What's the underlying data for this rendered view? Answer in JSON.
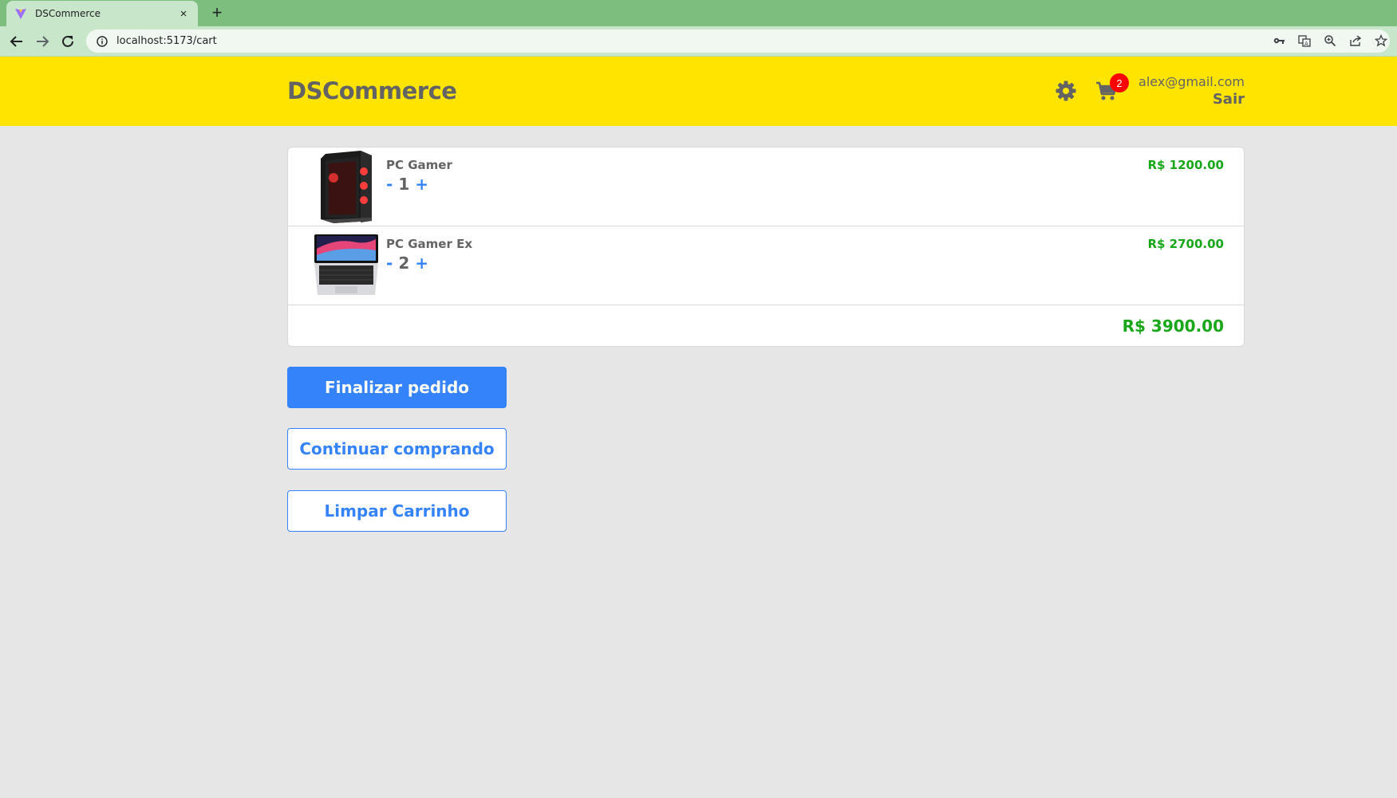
{
  "browser": {
    "tab_title": "DSCommerce",
    "tab_close": "×",
    "new_tab": "+",
    "url": "localhost:5173/cart",
    "icons": [
      "back-icon",
      "forward-icon",
      "reload-icon",
      "info-icon",
      "key-icon",
      "translate-icon",
      "zoom-icon",
      "share-icon",
      "star-icon"
    ]
  },
  "header": {
    "logo": "DSCommerce",
    "cart_count": "2",
    "user_email": "alex@gmail.com",
    "logout_label": "Sair",
    "colors": {
      "background": "#ffe400",
      "text": "#636363",
      "badge": "#ff0000"
    }
  },
  "cart": {
    "items": [
      {
        "name": "PC Gamer",
        "quantity": "1",
        "decrement": "-",
        "increment": "+",
        "price": "R$ 1200.00",
        "image": "pc-gamer-tower-image"
      },
      {
        "name": "PC Gamer Ex",
        "quantity": "2",
        "decrement": "-",
        "increment": "+",
        "price": "R$ 2700.00",
        "image": "laptop-image"
      }
    ],
    "total": "R$ 3900.00",
    "colors": {
      "price": "#17a718",
      "accent": "#3483fa"
    }
  },
  "actions": {
    "checkout_label": "Finalizar pedido",
    "continue_label": "Continuar comprando",
    "clear_label": "Limpar Carrinho"
  }
}
